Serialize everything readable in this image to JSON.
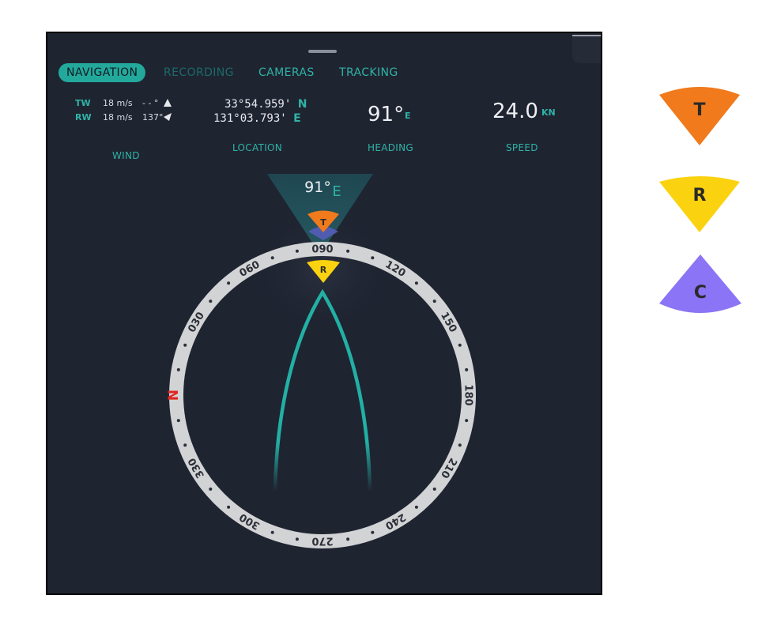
{
  "tabs": [
    {
      "label": "NAVIGATION",
      "state": "active"
    },
    {
      "label": "RECORDING",
      "state": "disabled"
    },
    {
      "label": "CAMERAS",
      "state": "normal"
    },
    {
      "label": "TRACKING",
      "state": "normal"
    }
  ],
  "wind": {
    "tw": {
      "label": "TW",
      "speed": "18 m/s",
      "angle": "- - °"
    },
    "rw": {
      "label": "RW",
      "speed": "18 m/s",
      "angle": "137°"
    },
    "caption": "WIND"
  },
  "location": {
    "lat": "33°54.959'",
    "lat_hemi": "N",
    "lon": "131°03.793'",
    "lon_hemi": "E",
    "caption": "LOCATION"
  },
  "heading": {
    "value": "91°",
    "dir": "E",
    "caption": "HEADING"
  },
  "speed": {
    "value": "24.0",
    "unit": "KN",
    "caption": "SPEED"
  },
  "compass": {
    "heading_value": "91°",
    "heading_dir": "E",
    "north_label": "N",
    "tick_labels": [
      "060",
      "090",
      "120",
      "150",
      "180",
      "210",
      "240",
      "270",
      "300",
      "330",
      "030"
    ]
  },
  "markers": [
    {
      "letter": "T",
      "color": "#f07a1c"
    },
    {
      "letter": "R",
      "color": "#fbd20f"
    },
    {
      "letter": "C",
      "color": "#8b74f5"
    }
  ],
  "colors": {
    "accent": "#2fb3a6",
    "panel": "#1f2431",
    "ring": "#d2d3d5",
    "north": "#e0261f"
  }
}
